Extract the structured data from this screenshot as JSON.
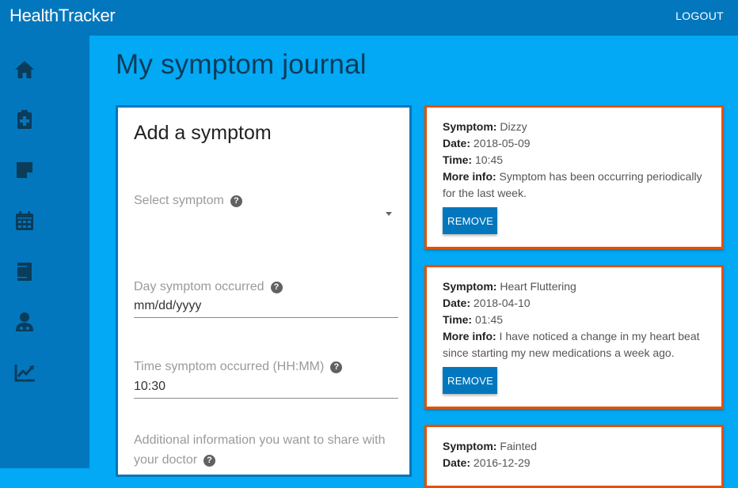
{
  "app": {
    "title": "HealthTracker",
    "logout_label": "LOGOUT"
  },
  "sidebar": {
    "items": [
      {
        "name": "home",
        "icon": "home-icon"
      },
      {
        "name": "medical",
        "icon": "clipboard-plus-icon"
      },
      {
        "name": "notes",
        "icon": "note-icon"
      },
      {
        "name": "calendar",
        "icon": "calendar-icon"
      },
      {
        "name": "records",
        "icon": "document-icon"
      },
      {
        "name": "doctor",
        "icon": "doctor-icon"
      },
      {
        "name": "trends",
        "icon": "chart-icon"
      }
    ]
  },
  "page": {
    "title": "My symptom journal"
  },
  "form": {
    "title": "Add a symptom",
    "symptom_label": "Select symptom",
    "symptom_value": "",
    "day_label": "Day symptom occurred",
    "day_value": "mm/dd/yyyy",
    "time_label": "Time symptom occurred (HH:MM)",
    "time_value": "10:30",
    "info_label": "Additional information you want to share with your doctor",
    "help_glyph": "?"
  },
  "entry_labels": {
    "symptom": "Symptom:",
    "date": "Date:",
    "time": "Time:",
    "info": "More info:",
    "remove": "REMOVE"
  },
  "entries": [
    {
      "symptom": "Dizzy",
      "date": "2018-05-09",
      "time": "10:45",
      "info": "Symptom has been occurring periodically for the last week."
    },
    {
      "symptom": "Heart Fluttering",
      "date": "2018-04-10",
      "time": "01:45",
      "info": "I have noticed a change in my heart beat since starting my new medications a week ago."
    },
    {
      "symptom": "Fainted",
      "date": "2016-12-29"
    }
  ],
  "colors": {
    "background": "#03a9f4",
    "primary": "#0277bd",
    "accent": "#e65100"
  }
}
